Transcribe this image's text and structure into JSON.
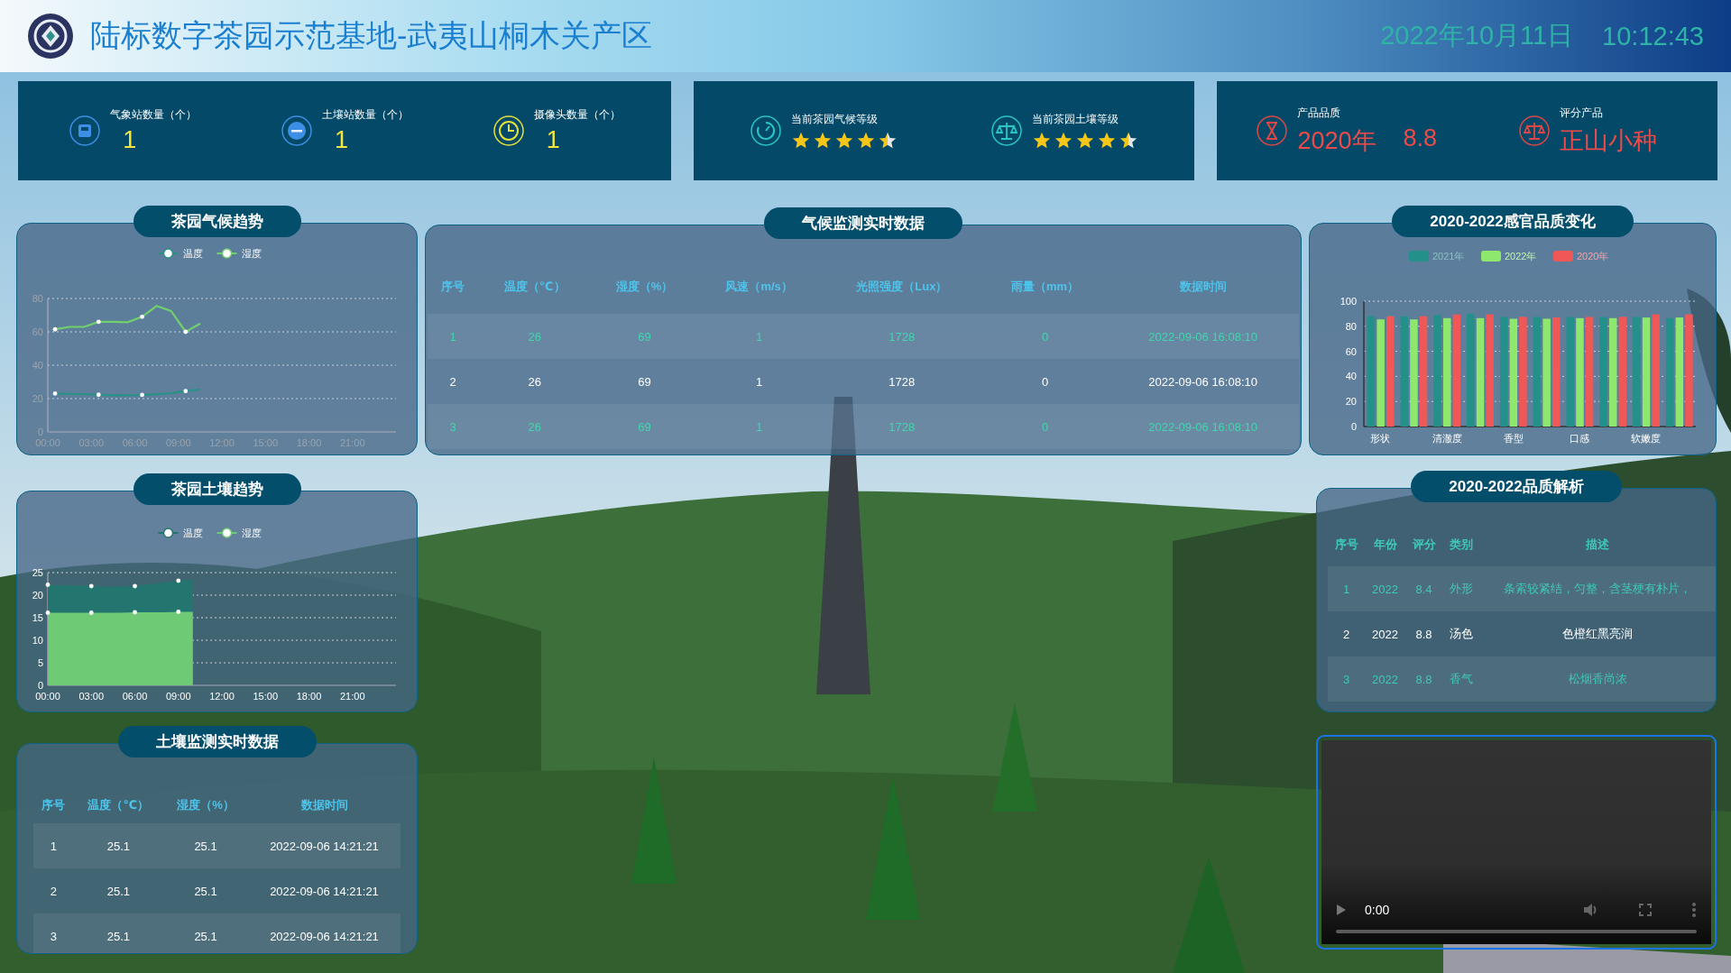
{
  "header": {
    "title": "陆标数字茶园示范基地-武夷山桐木关产区",
    "date": "2022年10月11日",
    "time": "10:12:43"
  },
  "stat_cards": [
    {
      "kind": "counts",
      "items": [
        {
          "label": "气象站数量（个）",
          "value": "1"
        },
        {
          "label": "土壤站数量（个）",
          "value": "1"
        },
        {
          "label": "摄像头数量（个）",
          "value": "1"
        }
      ]
    },
    {
      "kind": "ratings",
      "items": [
        {
          "label": "当前茶园气候等级",
          "stars": 4.5
        },
        {
          "label": "当前茶园土壤等级",
          "stars": 4.5
        }
      ]
    },
    {
      "kind": "products",
      "items": [
        {
          "label": "产品品质",
          "values": [
            "2020年",
            "8.8"
          ]
        },
        {
          "label": "评分产品",
          "values": [
            "正山小种"
          ]
        }
      ]
    }
  ],
  "climate_trend": {
    "title": "茶园气候趋势",
    "chart_data": {
      "type": "line",
      "grid": true,
      "legend": "top",
      "x": [
        0.5,
        1.5,
        2.5,
        3.5,
        4.5,
        5.5,
        6.5,
        7.5,
        8.5,
        9.5,
        10.5
      ],
      "xlim": [
        0,
        24
      ],
      "ylim": [
        0,
        80
      ],
      "xticks": [
        {
          "value": 0,
          "label": "00:00"
        },
        {
          "value": 3,
          "label": "03:00"
        },
        {
          "value": 6,
          "label": "06:00"
        },
        {
          "value": 9,
          "label": "09:00"
        },
        {
          "value": 12,
          "label": "12:00"
        },
        {
          "value": 15,
          "label": "15:00"
        },
        {
          "value": 18,
          "label": "18:00"
        },
        {
          "value": 21,
          "label": "21:00"
        }
      ],
      "yticks": [
        0,
        20,
        40,
        60,
        80
      ],
      "series": [
        {
          "name": "温度",
          "color": "#2a9088",
          "values": [
            23,
            22.8,
            22.6,
            22.3,
            22,
            22,
            22.2,
            22.6,
            23.2,
            24.5,
            25.5
          ]
        },
        {
          "name": "湿度",
          "color": "#72cf6e",
          "values": [
            61.5,
            63,
            63,
            66,
            66,
            65.8,
            69,
            75.5,
            72.5,
            60,
            65
          ]
        }
      ]
    }
  },
  "soil_trend": {
    "title": "茶园土壤趋势",
    "chart_data": {
      "type": "area",
      "grid": true,
      "legend": "top",
      "x": [
        0,
        1,
        2,
        3,
        4,
        5,
        6,
        7,
        8,
        9,
        10
      ],
      "xlim": [
        0,
        24
      ],
      "ylim": [
        0,
        25
      ],
      "xticks": [
        {
          "value": 0,
          "label": "00:00"
        },
        {
          "value": 3,
          "label": "03:00"
        },
        {
          "value": 6,
          "label": "06:00"
        },
        {
          "value": 9,
          "label": "09:00"
        },
        {
          "value": 12,
          "label": "12:00"
        },
        {
          "value": 15,
          "label": "15:00"
        },
        {
          "value": 18,
          "label": "18:00"
        },
        {
          "value": 21,
          "label": "21:00"
        }
      ],
      "yticks": [
        0,
        5,
        10,
        15,
        20,
        25
      ],
      "series": [
        {
          "name": "温度",
          "color": "#23766f",
          "values": [
            22.3,
            22.2,
            22.1,
            22,
            21.9,
            21.9,
            22,
            22.4,
            22.8,
            23.2,
            23.4
          ]
        },
        {
          "name": "湿度",
          "color": "#6fca76",
          "values": [
            16.1,
            16.1,
            16.1,
            16.1,
            16.1,
            16.1,
            16.2,
            16.2,
            16.2,
            16.3,
            16.3
          ]
        }
      ]
    }
  },
  "soil_table": {
    "title": "土壤监测实时数据",
    "columns": [
      "序号",
      "温度（℃）",
      "湿度（%）",
      "数据时间"
    ],
    "rows": [
      [
        "1",
        "25.1",
        "25.1",
        "2022-09-06 14:21:21"
      ],
      [
        "2",
        "25.1",
        "25.1",
        "2022-09-06 14:21:21"
      ],
      [
        "3",
        "25.1",
        "25.1",
        "2022-09-06 14:21:21"
      ]
    ]
  },
  "climate_table": {
    "title": "气候监测实时数据",
    "columns": [
      "序号",
      "温度（℃）",
      "湿度（%）",
      "风速（m/s）",
      "光照强度（Lux）",
      "雨量（mm）",
      "数据时间"
    ],
    "rows": [
      [
        "1",
        "26",
        "69",
        "1",
        "1728",
        "0",
        "2022-09-06 16:08:10"
      ],
      [
        "2",
        "26",
        "69",
        "1",
        "1728",
        "0",
        "2022-09-06 16:08:10"
      ],
      [
        "3",
        "26",
        "69",
        "1",
        "1728",
        "0",
        "2022-09-06 16:08:10"
      ]
    ]
  },
  "quality_chart": {
    "title": "2020-2022感官品质变化",
    "chart_data": {
      "type": "bar",
      "stacked": false,
      "grid": true,
      "legend": "top",
      "categories": [
        "形状",
        null,
        "清澈度",
        null,
        "香型",
        null,
        "口感",
        null,
        "软嫩度",
        null
      ],
      "ylim": [
        0,
        100
      ],
      "yticks": [
        0,
        20,
        40,
        60,
        80,
        100
      ],
      "series": [
        {
          "name": "2021年",
          "color": "#23908a",
          "values": [
            88,
            88,
            89,
            90,
            87.5,
            87.5,
            87.5,
            87.5,
            87.5,
            86.5
          ]
        },
        {
          "name": "2022年",
          "color": "#8ee86e",
          "values": [
            85.5,
            85.5,
            86.5,
            86.5,
            86,
            86,
            86.5,
            86.5,
            87,
            87
          ]
        },
        {
          "name": "2020年",
          "color": "#f05858",
          "values": [
            88,
            88,
            89.5,
            89.5,
            87.5,
            87,
            87.5,
            87.5,
            89.5,
            89.5
          ]
        }
      ]
    }
  },
  "quality_table": {
    "title": "2020-2022品质解析",
    "columns": [
      "序号",
      "年份",
      "评分",
      "类别",
      "描述"
    ],
    "rows": [
      [
        "1",
        "2022",
        "8.4",
        "外形",
        "条索较紧结，匀整，含茎梗有朴片，"
      ],
      [
        "2",
        "2022",
        "8.8",
        "汤色",
        "色橙红黑亮润"
      ],
      [
        "3",
        "2022",
        "8.8",
        "香气",
        "松烟香尚浓"
      ]
    ]
  },
  "video": {
    "time": "0:00"
  }
}
